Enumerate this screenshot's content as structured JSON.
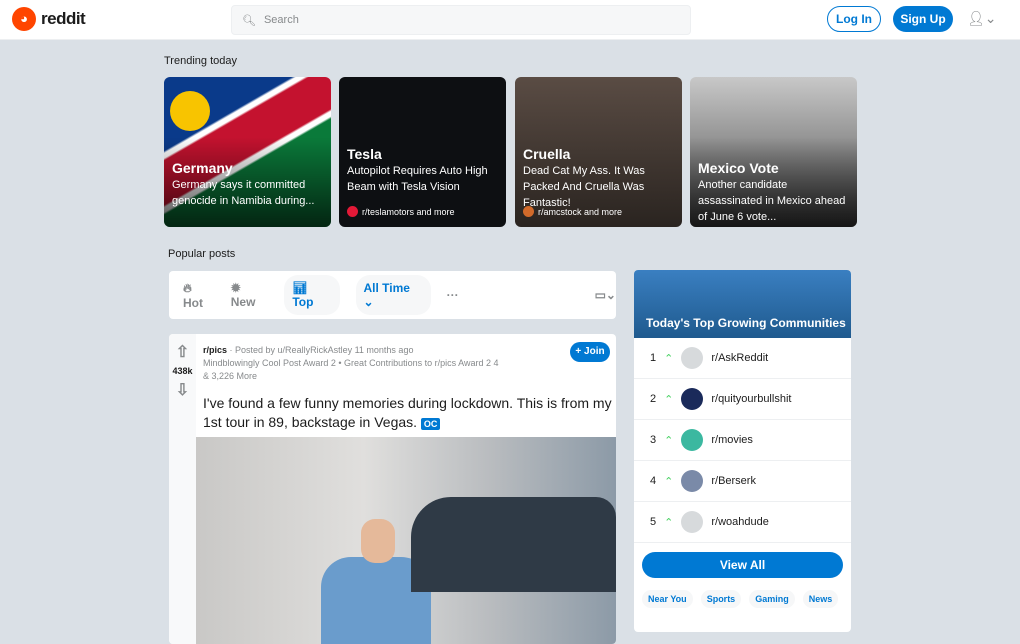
{
  "header": {
    "logo": "reddit",
    "search_placeholder": "Search",
    "login": "Log In",
    "signup": "Sign Up"
  },
  "trending": {
    "title": "Trending today",
    "cards": [
      {
        "title": "Germany",
        "desc": "Germany says it committed genocide in Namibia during...",
        "source": ""
      },
      {
        "title": "Tesla",
        "desc": "Autopilot Requires Auto High Beam with Tesla Vision",
        "source": "r/teslamotors and more"
      },
      {
        "title": "Cruella",
        "desc": "Dead Cat My Ass. It Was Packed And Cruella Was Fantastic!",
        "source": "r/amcstock and more"
      },
      {
        "title": "Mexico Vote",
        "desc": "Another candidate assassinated in Mexico ahead of June 6 vote...",
        "source": ""
      }
    ]
  },
  "popular": {
    "title": "Popular posts",
    "sort": {
      "hot": "Hot",
      "new": "New",
      "top": "Top",
      "time": "All Time ⌄",
      "more": "···"
    }
  },
  "post": {
    "votes": "438k",
    "subreddit": "r/pics",
    "posted": "· Posted by u/ReallyRickAstley 11 months ago",
    "awards": "Mindblowingly Cool Post Award 2 • Great Contributions to r/pics Award 2 4",
    "more_awards": "& 3,226 More",
    "join": "+ Join",
    "title": "I've found a few funny memories during lockdown. This is from my 1st tour in 89, backstage in Vegas.",
    "flair": "OC"
  },
  "sidebar": {
    "title": "Today's Top Growing Communities",
    "communities": [
      {
        "rank": "1",
        "name": "r/AskReddit"
      },
      {
        "rank": "2",
        "name": "r/quityourbullshit"
      },
      {
        "rank": "3",
        "name": "r/movies"
      },
      {
        "rank": "4",
        "name": "r/Berserk"
      },
      {
        "rank": "5",
        "name": "r/woahdude"
      }
    ],
    "view_all": "View All",
    "tags": [
      "Near You",
      "Sports",
      "Gaming",
      "News"
    ]
  }
}
